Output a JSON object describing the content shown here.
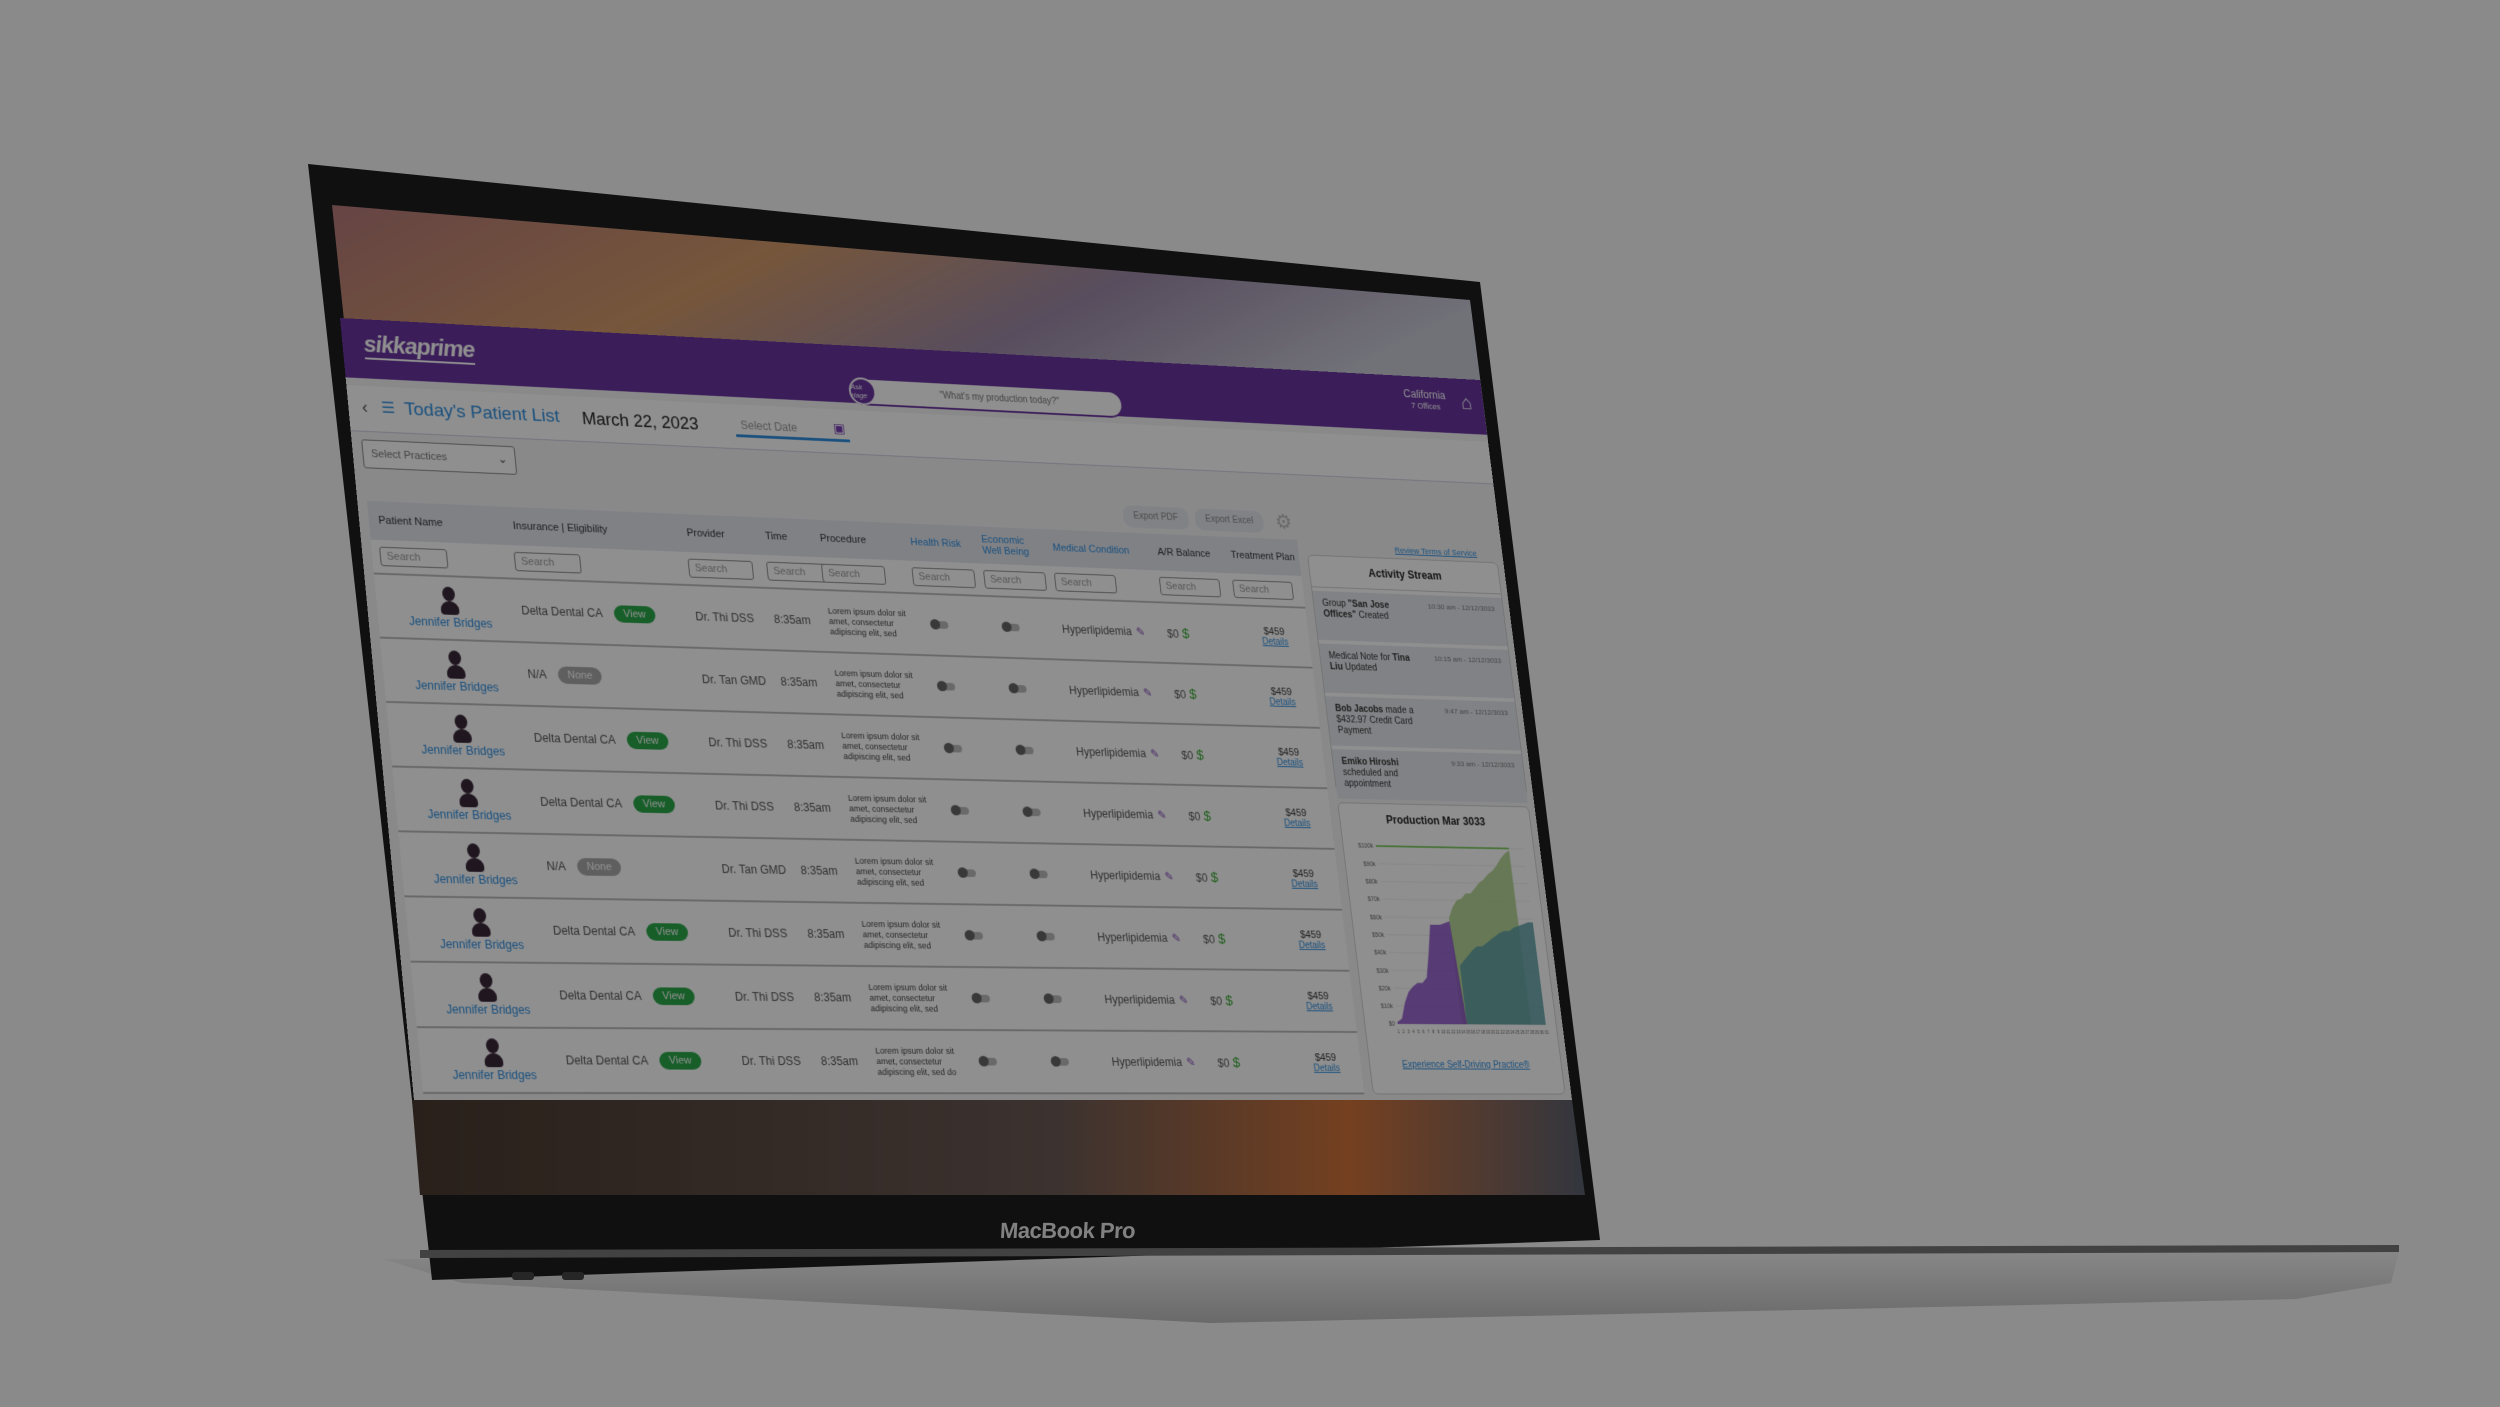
{
  "device_label": "MacBook Pro",
  "header": {
    "logo": "sikkaprime",
    "ask_badge": "Ask riage",
    "ask_prompt": "\"What's my production today?\"",
    "location": "California",
    "offices": "7 Offices",
    "brand_color": "#6a35a0"
  },
  "subheader": {
    "title": "Today's Patient List",
    "date": "March 22, 2023",
    "date_placeholder": "Select Date",
    "practices_placeholder": "Select Practices"
  },
  "toolbar": {
    "export_pdf": "Export PDF",
    "export_excel": "Export Excel",
    "terms_link": "Review Terms of Service"
  },
  "table": {
    "columns": [
      "Patient Name",
      "Insurance | Eligibility",
      "Provider",
      "Time",
      "Procedure",
      "Health Risk",
      "Economic Well Being",
      "Medical Condition",
      "A/R Balance",
      "Treatment Plan"
    ],
    "search_placeholder": "Search",
    "rows": [
      {
        "name": "Jennifer Bridges",
        "insurance": "Delta Dental CA",
        "eligibility": "View",
        "provider": "Dr. Thi DSS",
        "time": "8:35am",
        "procedure": "Lorem ipsum dolor sit amet, consectetur adipiscing elit, sed",
        "condition": "Hyperlipidemia",
        "ar": "$0",
        "plan": "$459",
        "details": "Details"
      },
      {
        "name": "Jennifer Bridges",
        "insurance": "N/A",
        "eligibility": "None",
        "provider": "Dr. Tan GMD",
        "time": "8:35am",
        "procedure": "Lorem ipsum dolor sit amet, consectetur adipiscing elit, sed",
        "condition": "Hyperlipidemia",
        "ar": "$0",
        "plan": "$459",
        "details": "Details"
      },
      {
        "name": "Jennifer Bridges",
        "insurance": "Delta Dental CA",
        "eligibility": "View",
        "provider": "Dr. Thi DSS",
        "time": "8:35am",
        "procedure": "Lorem ipsum dolor sit amet, consectetur adipiscing elit, sed",
        "condition": "Hyperlipidemia",
        "ar": "$0",
        "plan": "$459",
        "details": "Details"
      },
      {
        "name": "Jennifer Bridges",
        "insurance": "Delta Dental CA",
        "eligibility": "View",
        "provider": "Dr. Thi DSS",
        "time": "8:35am",
        "procedure": "Lorem ipsum dolor sit amet, consectetur adipiscing elit, sed",
        "condition": "Hyperlipidemia",
        "ar": "$0",
        "plan": "$459",
        "details": "Details"
      },
      {
        "name": "Jennifer Bridges",
        "insurance": "N/A",
        "eligibility": "None",
        "provider": "Dr. Tan GMD",
        "time": "8:35am",
        "procedure": "Lorem ipsum dolor sit amet, consectetur adipiscing elit, sed",
        "condition": "Hyperlipidemia",
        "ar": "$0",
        "plan": "$459",
        "details": "Details"
      },
      {
        "name": "Jennifer Bridges",
        "insurance": "Delta Dental CA",
        "eligibility": "View",
        "provider": "Dr. Thi DSS",
        "time": "8:35am",
        "procedure": "Lorem ipsum dolor sit amet, consectetur adipiscing elit, sed",
        "condition": "Hyperlipidemia",
        "ar": "$0",
        "plan": "$459",
        "details": "Details"
      },
      {
        "name": "Jennifer Bridges",
        "insurance": "Delta Dental CA",
        "eligibility": "View",
        "provider": "Dr. Thi DSS",
        "time": "8:35am",
        "procedure": "Lorem ipsum dolor sit amet, consectetur adipiscing elit, sed",
        "condition": "Hyperlipidemia",
        "ar": "$0",
        "plan": "$459",
        "details": "Details"
      },
      {
        "name": "Jennifer Bridges",
        "insurance": "Delta Dental CA",
        "eligibility": "View",
        "provider": "Dr. Thi DSS",
        "time": "8:35am",
        "procedure": "Lorem ipsum dolor sit amet, consectetur adipiscing elit, sed do",
        "condition": "Hyperlipidemia",
        "ar": "$0",
        "plan": "$459",
        "details": "Details"
      }
    ]
  },
  "activity": {
    "title": "Activity Stream",
    "items": [
      {
        "pre": "Group ",
        "bold": "\"San Jose Offices\"",
        "post": " Created",
        "time": "10:30 am - 12/12/3033"
      },
      {
        "pre": "Medical Note for ",
        "bold": "Tina Liu",
        "post": " Updated",
        "time": "10:15 am - 12/12/3033"
      },
      {
        "pre": "",
        "bold": "Bob Jacobs",
        "post": " made a $432.97 Credit Card Payment",
        "time": "9:47 am - 12/12/3033"
      },
      {
        "pre": "",
        "bold": "Emiko Hiroshi",
        "post": " scheduled and appointment",
        "time": "9:33 am - 12/12/3033"
      }
    ]
  },
  "production": {
    "cta": "Experience Self-Driving Practice®"
  },
  "chart_data": {
    "type": "area",
    "title": "Production Mar 3033",
    "y_ticks": [
      "$0",
      "$10k",
      "$20k",
      "$30k",
      "$40k",
      "$50k",
      "$60k",
      "$70k",
      "$80k",
      "$90k",
      "$100k"
    ],
    "ylim": [
      0,
      100000
    ],
    "xlim": [
      1,
      31
    ],
    "x_ticks": [
      1,
      2,
      3,
      4,
      5,
      6,
      7,
      8,
      9,
      10,
      11,
      12,
      13,
      14,
      15,
      16,
      17,
      18,
      19,
      20,
      21,
      22,
      23,
      24,
      25,
      26,
      27,
      28,
      29,
      30,
      31
    ],
    "goal": 100000,
    "goal_color": "#5cc03a",
    "series": [
      {
        "color": "#8a4fc7",
        "x": [
          1,
          2,
          3,
          4,
          5,
          6,
          7,
          8,
          9,
          10,
          11,
          12,
          13,
          14,
          15
        ],
        "values": [
          1000,
          3000,
          12000,
          18000,
          21000,
          23000,
          23000,
          26000,
          40000,
          56000,
          56000,
          56000,
          57000,
          58000,
          0
        ]
      },
      {
        "color": "#a9cf86",
        "x": [
          14,
          15,
          16,
          17,
          18,
          19,
          20,
          21,
          22,
          23,
          24,
          25,
          26,
          27,
          28
        ],
        "values": [
          60000,
          66000,
          70000,
          71000,
          74000,
          74000,
          77000,
          80000,
          82000,
          85000,
          87000,
          90000,
          94000,
          97000,
          99000
        ]
      },
      {
        "color": "#5c9fa6",
        "x": [
          15,
          16,
          17,
          18,
          19,
          20,
          21,
          22,
          23,
          24,
          25,
          26,
          27,
          28,
          29,
          30,
          31
        ],
        "values": [
          33000,
          36000,
          39000,
          42000,
          44000,
          44000,
          46000,
          48000,
          50000,
          52000,
          53000,
          53000,
          55000,
          56000,
          57000,
          58000,
          58000
        ]
      }
    ]
  }
}
